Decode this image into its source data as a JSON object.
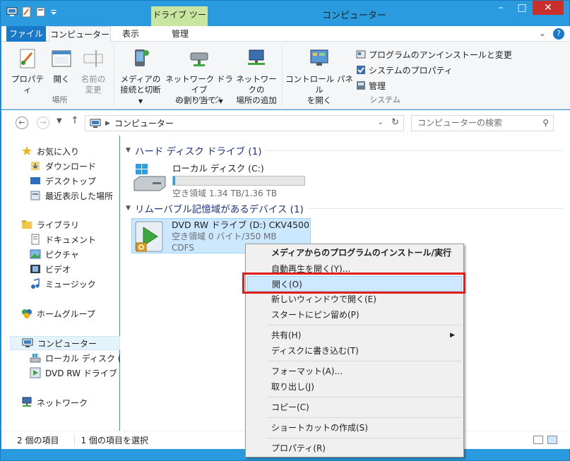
{
  "window": {
    "title": "コンピューター",
    "context_tab_label": "ドライブ ツール"
  },
  "tabs": {
    "file": "ファイル",
    "computer": "コンピューター",
    "view": "表示",
    "manage": "管理"
  },
  "ribbon": {
    "location_group": {
      "label": "場所",
      "properties": "プロパティ",
      "open": "開く",
      "rename_line1": "名前の",
      "rename_line2": "変更"
    },
    "network_group": {
      "label": "ネットワーク",
      "media_line1": "メディアの",
      "media_line2": "接続と切断",
      "map_drive_line1": "ネットワーク ドライブ",
      "map_drive_line2": "の割り当て",
      "add_location_line1": "ネットワークの",
      "add_location_line2": "場所の追加"
    },
    "system_group": {
      "label": "システム",
      "control_panel_line1": "コントロール パネル",
      "control_panel_line2": "を開く",
      "uninstall": "プログラムのアンインストールと変更",
      "system_properties": "システムのプロパティ",
      "manage": "管理"
    }
  },
  "address": {
    "path": "コンピューター",
    "search_placeholder": "コンピューターの検索"
  },
  "nav_pane": {
    "favorites": "お気に入り",
    "downloads": "ダウンロード",
    "desktop": "デスクトップ",
    "recent": "最近表示した場所",
    "libraries": "ライブラリ",
    "documents": "ドキュメント",
    "pictures": "ピクチャ",
    "videos": "ビデオ",
    "music": "ミュージック",
    "homegroup": "ホームグループ",
    "computer": "コンピューター",
    "local_disk": "ローカル ディスク (C:)",
    "dvd_drive": "DVD RW ドライブ (D",
    "network": "ネットワーク"
  },
  "content": {
    "hdd_section": "ハード ディスク ドライブ (1)",
    "removable_section": "リムーバブル記憶域があるデバイス (1)",
    "local_disk": {
      "name": "ローカル ディスク (C:)",
      "free": "空き領域 1.34 TB/1.36 TB",
      "used_fraction": 0.015
    },
    "dvd": {
      "name": "DVD RW ドライブ (D:) CKV4500",
      "free": "空き領域 0 バイト/350 MB",
      "fs": "CDFS"
    }
  },
  "context_menu": {
    "install_from_media": "メディアからのプログラムのインストール/実行",
    "autoplay": "自動再生を開く(Y)...",
    "open": "開く(O)",
    "open_new_window": "新しいウィンドウで開く(E)",
    "pin_start": "スタートにピン留め(P)",
    "share": "共有(H)",
    "burn": "ディスクに書き込む(T)",
    "format": "フォーマット(A)...",
    "eject": "取り出し(J)",
    "copy": "コピー(C)",
    "create_shortcut": "ショートカットの作成(S)",
    "properties": "プロパティ(R)"
  },
  "statusbar": {
    "item_count": "2 個の項目",
    "selected": "1 個の項目を選択"
  },
  "colors": {
    "title_blue": "#2b9be0",
    "file_tab": "#1979ca",
    "context_tab": "#c8e6a0",
    "highlight": "#e21d1d",
    "selection": "#cde8ff"
  }
}
